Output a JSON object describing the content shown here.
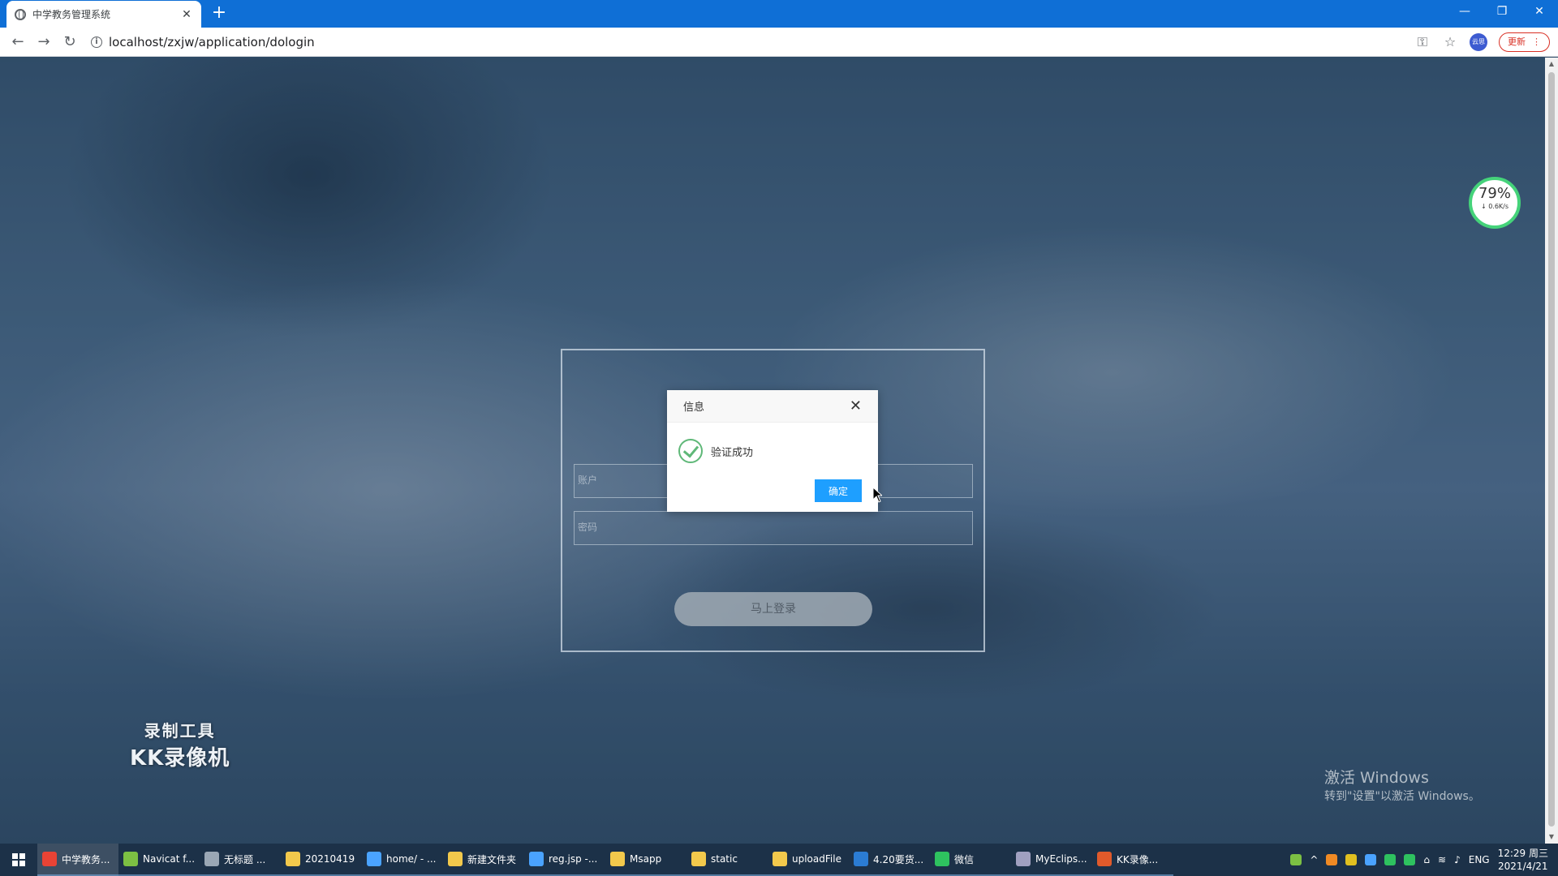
{
  "browser": {
    "tab_title": "中学教务管理系统",
    "url": "localhost/zxjw/application/dologin",
    "update_label": "更新",
    "profile_label": "云思"
  },
  "login": {
    "username_placeholder": "账户",
    "password_placeholder": "密码",
    "submit_label": "马上登录"
  },
  "dialog": {
    "title": "信息",
    "message": "验证成功",
    "ok_label": "确定"
  },
  "overlay": {
    "net_percent": "79%",
    "net_speed": "↓ 0.6K/s",
    "recorder_line1": "录制工具",
    "recorder_line2": "KK录像机",
    "activate_line1": "激活 Windows",
    "activate_line2": "转到\"设置\"以激活 Windows。"
  },
  "taskbar": {
    "items": [
      {
        "label": "中学教务...",
        "color": "#e94335"
      },
      {
        "label": "Navicat f...",
        "color": "#7cc043"
      },
      {
        "label": "无标题 ...",
        "color": "#9aa7b5"
      },
      {
        "label": "20210419",
        "color": "#f2c94c"
      },
      {
        "label": "home/ - ...",
        "color": "#4aa3ff"
      },
      {
        "label": "新建文件夹",
        "color": "#f2c94c"
      },
      {
        "label": "reg.jsp -...",
        "color": "#4aa3ff"
      },
      {
        "label": "Msapp",
        "color": "#f2c94c"
      },
      {
        "label": "static",
        "color": "#f2c94c"
      },
      {
        "label": "uploadFile",
        "color": "#f2c94c"
      },
      {
        "label": "4.20要货...",
        "color": "#2b7cd3"
      },
      {
        "label": "微信",
        "color": "#2ec25f"
      },
      {
        "label": "MyEclips...",
        "color": "#a0a0c0"
      },
      {
        "label": "KK录像...",
        "color": "#e05a2b"
      }
    ],
    "lang": "ENG",
    "time": "12:29 周三",
    "date": "2021/4/21"
  }
}
